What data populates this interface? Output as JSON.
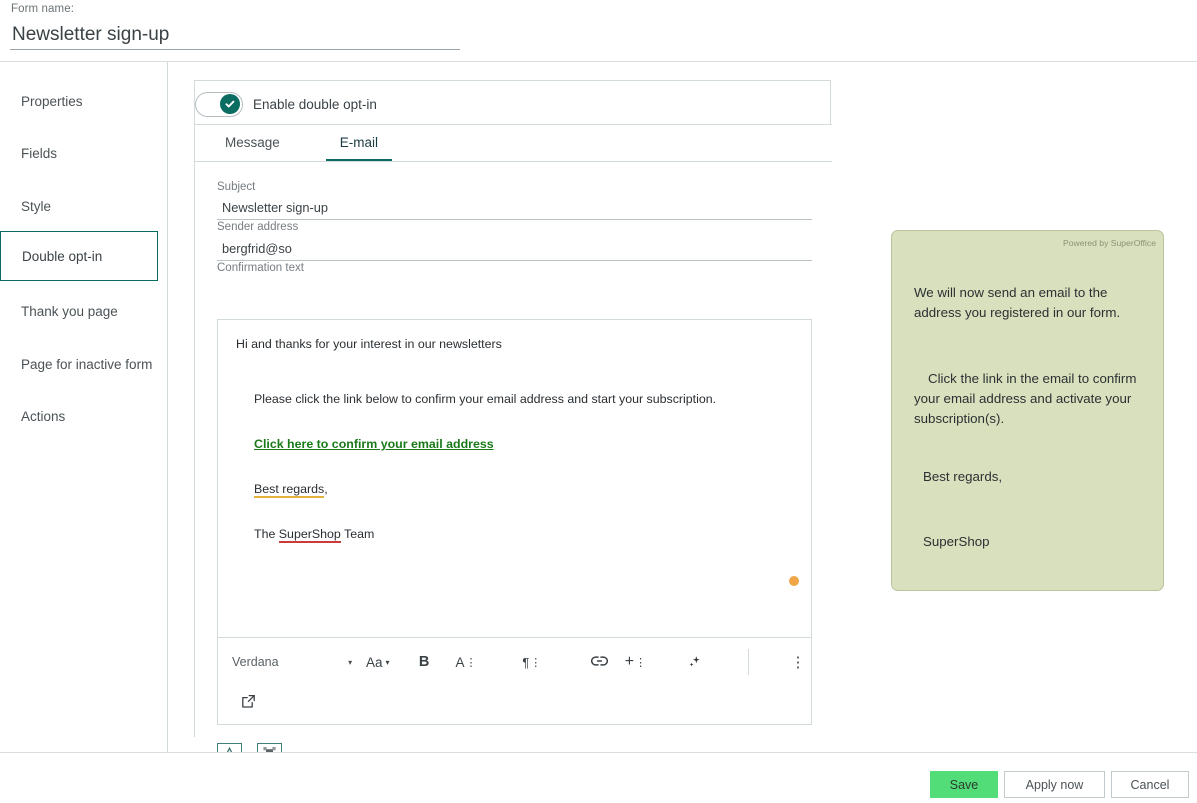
{
  "header": {
    "form_name_label": "Form name:",
    "form_name_value": "Newsletter sign-up",
    "form_name_placeholder": "Form name"
  },
  "sidebar": {
    "items": [
      {
        "label": "Properties",
        "active": false
      },
      {
        "label": "Fields",
        "active": false
      },
      {
        "label": "Style",
        "active": false
      },
      {
        "label": "Double opt-in",
        "active": true
      },
      {
        "label": "Thank you page",
        "active": false
      },
      {
        "label": "Page for inactive form",
        "active": false
      },
      {
        "label": "Actions",
        "active": false
      }
    ]
  },
  "main": {
    "toggle": {
      "label": "Enable double opt-in",
      "state": "on",
      "icon": "check-icon"
    },
    "tabs": [
      {
        "label": "Message",
        "active": false
      },
      {
        "label": "E-mail",
        "active": true
      }
    ],
    "fields": {
      "subject_label": "Subject",
      "subject_value": "Newsletter sign-up",
      "subject_placeholder": "Subject",
      "sender_label": "Sender address",
      "sender_value": "bergfrid@so",
      "sender_placeholder": "Sender address",
      "confirmation_label": "Confirmation text"
    },
    "editor": {
      "greeting": "Hi and thanks for your interest in our newsletters",
      "paragraph": "Please click the link below to confirm your email address and start your subscription.",
      "link_text": "Click here to confirm your email address",
      "regards_misspelled": "Best regards",
      "regards_tail": ",",
      "signature_prefix": "The ",
      "signature_misspelled": "SuperShop",
      "signature_suffix": " Team",
      "unsaved_indicator_color": "#f0a546"
    },
    "toolbar": {
      "font_family": "Verdana",
      "font_family_caret": "▾",
      "font_size_label": "Aa",
      "font_size_caret": "▾",
      "bold_label": "B",
      "text_color_label": "A",
      "paragraph_label": "¶",
      "link_icon": "link-icon",
      "insert_label": "+",
      "ai_icon": "sparkle-icon",
      "more_label": "⋮",
      "popout_icon": "open-in-new-icon"
    },
    "editor_footer": {
      "text_tool_label": "A",
      "text_tool_icon": "text-format-icon",
      "image_tool_icon": "image-resize-icon"
    }
  },
  "preview": {
    "powered_by": "Powered by SuperOffice",
    "paragraph_1": "We will now send an email to the address you registered in our form.",
    "paragraph_2": "Click the link in the email to confirm your email address and activate your subscription(s).",
    "paragraph_3": "Best regards,",
    "paragraph_4": "SuperShop",
    "background_color": "#d8e0bd"
  },
  "footer": {
    "save_label": "Save",
    "apply_label": "Apply now",
    "cancel_label": "Cancel",
    "save_color": "#52dd79"
  },
  "theme": {
    "accent": "#0a6b63",
    "link_green": "#1a7a1a",
    "border": "#d3dadc"
  }
}
